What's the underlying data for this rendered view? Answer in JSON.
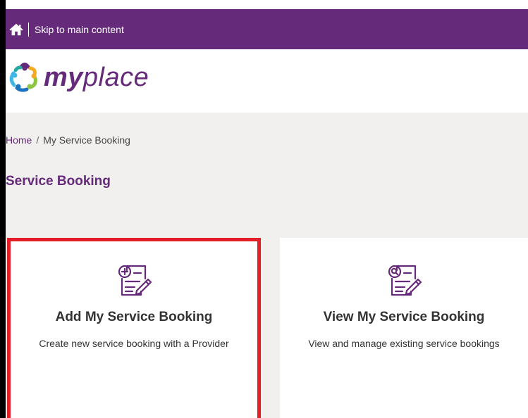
{
  "topbar": {
    "skip_link": "Skip to main content"
  },
  "logo": {
    "my": "my",
    "place": "place"
  },
  "breadcrumb": {
    "home": "Home",
    "separator": "/",
    "current": "My Service Booking"
  },
  "page": {
    "title": "Service Booking"
  },
  "cards": [
    {
      "title": "Add My Service Booking",
      "description": "Create new service booking with a Provider",
      "icon": "add-document-icon"
    },
    {
      "title": "View My Service Booking",
      "description": "View and manage existing service bookings",
      "icon": "search-document-icon"
    }
  ],
  "colors": {
    "brand": "#662a7a",
    "highlight": "#e41e26",
    "background": "#f1f0ee"
  }
}
